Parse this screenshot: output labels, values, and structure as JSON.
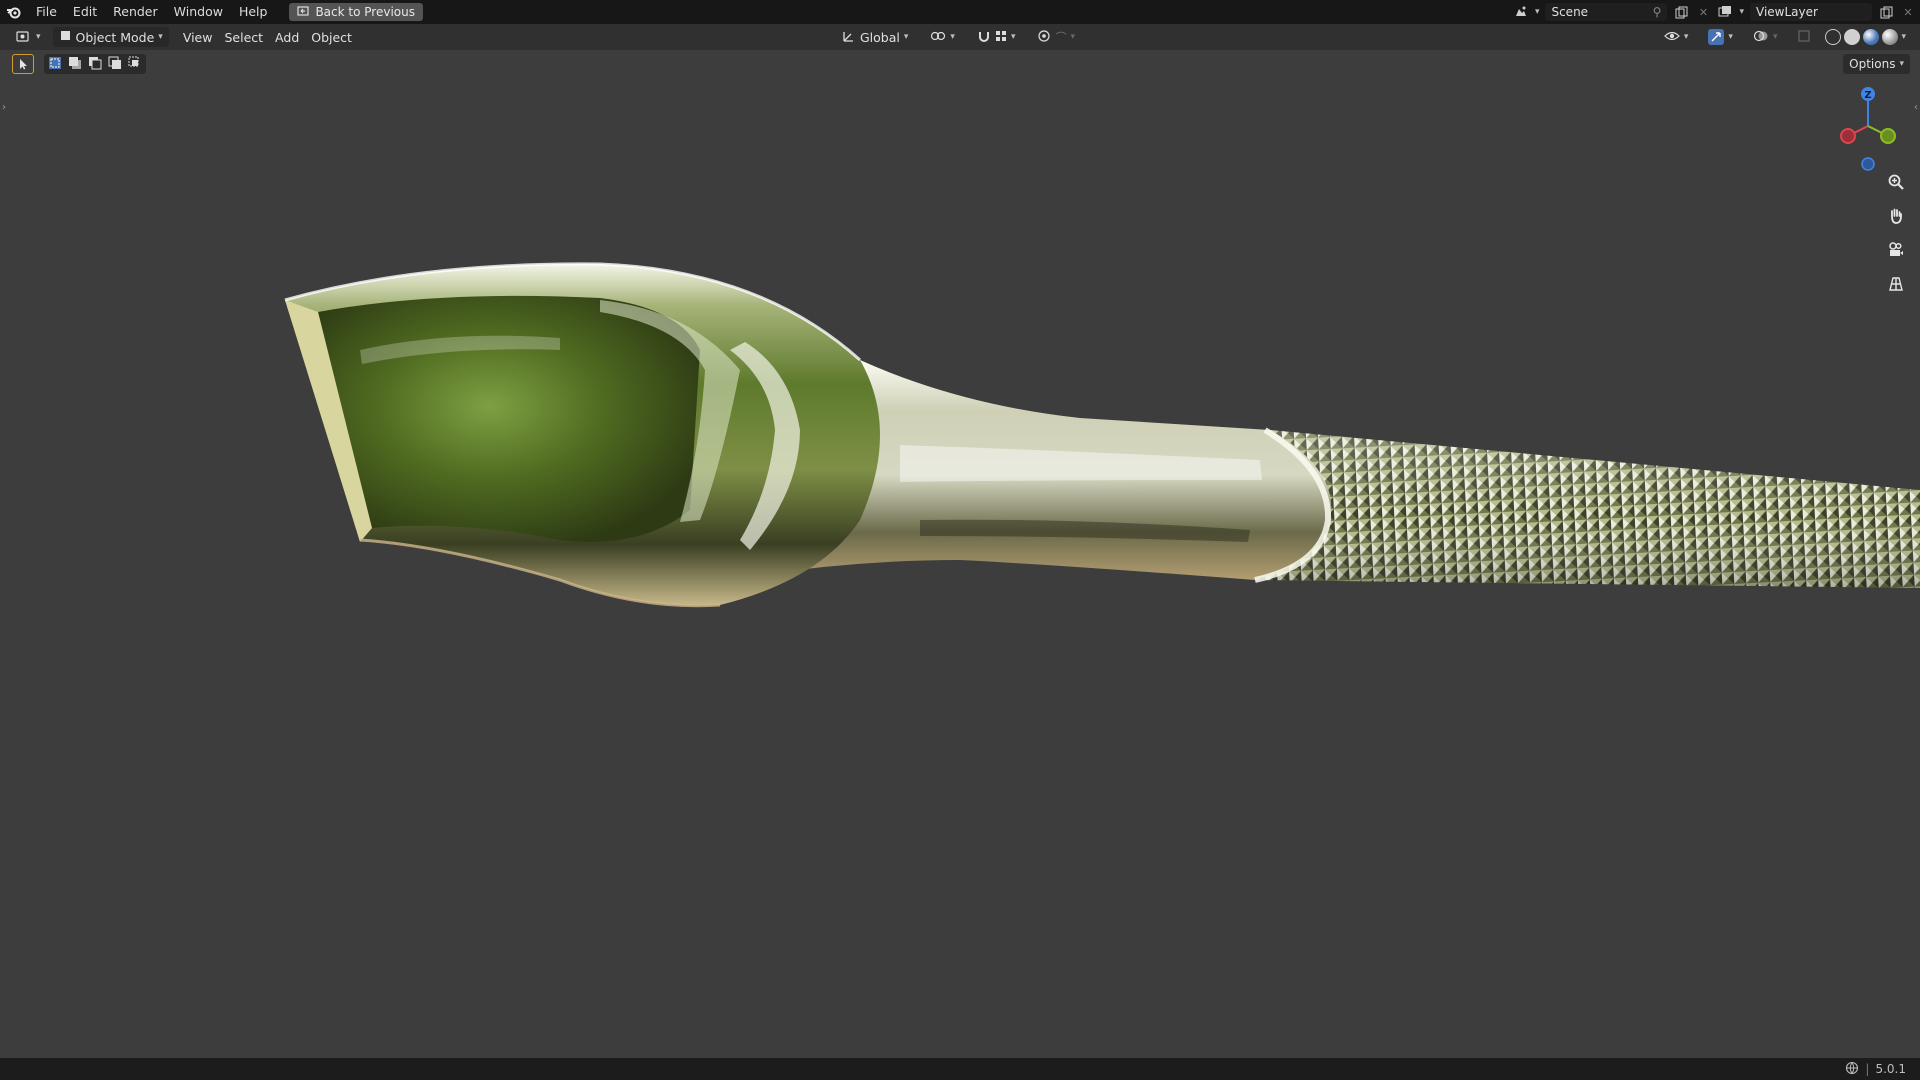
{
  "menu": {
    "items": [
      "File",
      "Edit",
      "Render",
      "Window",
      "Help"
    ],
    "back_button": "Back to Previous"
  },
  "top_right": {
    "scene": "Scene",
    "view_layer": "ViewLayer"
  },
  "header": {
    "mode": "Object Mode",
    "menus": [
      "View",
      "Select",
      "Add",
      "Object"
    ],
    "transform_orientation": "Global"
  },
  "options_label": "Options",
  "gizmo": {
    "z_label": "Z"
  },
  "status": {
    "version": "5.0.1"
  },
  "colors": {
    "topbar": "#171717",
    "header": "#303030",
    "viewport": "#3d3d3d",
    "accent": "#4772b3",
    "axis_x": "#e0454f",
    "axis_y": "#8cbe26",
    "axis_z": "#3f85e6"
  },
  "icons": [
    "blender-logo-icon",
    "back-icon",
    "scene-icon",
    "pin-icon",
    "copy-icon",
    "close-icon",
    "view-layer-icon",
    "editor-type-icon",
    "object-mode-icon",
    "global-icon",
    "pivot-icon",
    "snap-icon",
    "proportional-icon",
    "visibility-icon",
    "gizmo-icon",
    "overlay-icon",
    "xray-icon",
    "wireframe-icon",
    "solid-icon",
    "material-icon",
    "rendered-icon",
    "zoom-icon",
    "pan-icon",
    "camera-icon",
    "grid-icon",
    "select-box-icon",
    "network-icon"
  ]
}
